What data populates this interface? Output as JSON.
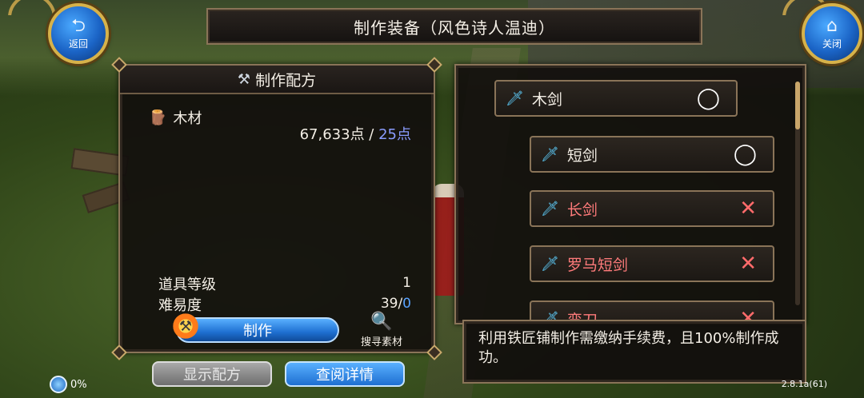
{
  "header": {
    "title": "制作装备（风色诗人温迪）"
  },
  "nav": {
    "back_label": "返回",
    "close_label": "关闭"
  },
  "recipe": {
    "heading": "制作配方",
    "material_name": "木材",
    "points_have": "67,633点",
    "points_sep": " / ",
    "points_need": "25点",
    "item_level_label": "道具等级",
    "item_level_value": "1",
    "difficulty_label": "难易度",
    "difficulty_value": "39/",
    "difficulty_extra": "0",
    "make_label": "制作",
    "search_label": "搜寻素材"
  },
  "buttons": {
    "show_recipe": "显示配方",
    "view_details": "查阅详情"
  },
  "item_list": [
    {
      "name": "木剑",
      "status": "available",
      "mark": "◯"
    },
    {
      "name": "短剑",
      "status": "available",
      "mark": "◯"
    },
    {
      "name": "长剑",
      "status": "unavailable",
      "mark": "✕"
    },
    {
      "name": "罗马短剑",
      "status": "unavailable",
      "mark": "✕"
    },
    {
      "name": "弯刀",
      "status": "unavailable",
      "mark": "✕"
    }
  ],
  "info": {
    "text": "利用铁匠铺制作需缴纳手续费，且100%制作成功。"
  },
  "footer": {
    "progress": "0%",
    "version": "2.8.1a(61)"
  },
  "colors": {
    "accent_blue": "#1e6fd1",
    "need_color": "#8a9cff",
    "bad_color": "#ff7b7b",
    "frame": "#8a7458"
  }
}
